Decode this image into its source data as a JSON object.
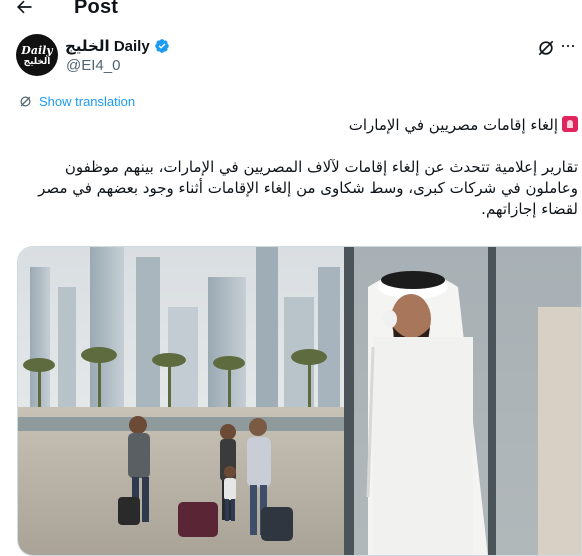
{
  "header": {
    "title": "Post",
    "back_icon": "arrow-left-icon"
  },
  "author": {
    "avatar_line1": "Daily",
    "avatar_line2": "الخليج",
    "display_name": "الخليج Daily",
    "handle": "@EI4_0",
    "verified_color": "#1d9bf0"
  },
  "actions": {
    "grok_icon": "grok-icon",
    "more_icon": "more-dots-icon"
  },
  "translate": {
    "label": "Show translation",
    "color": "#1d9bf0"
  },
  "tweet": {
    "headline": "إلغاء إقامات مصريين في الإمارات",
    "paragraph": "تقارير إعلامية تتحدث عن إلغاء إقامات لآلاف المصريين في الإمارات، بينهم موظفون وعاملون في شركات كبرى، وسط شكاوى من إلغاء الإقامات أثناء وجود بعضهم في مصر لقضاء إجازاتهم."
  },
  "colors": {
    "text": "#0f1419",
    "secondary": "#536471",
    "accent": "#1d9bf0"
  }
}
